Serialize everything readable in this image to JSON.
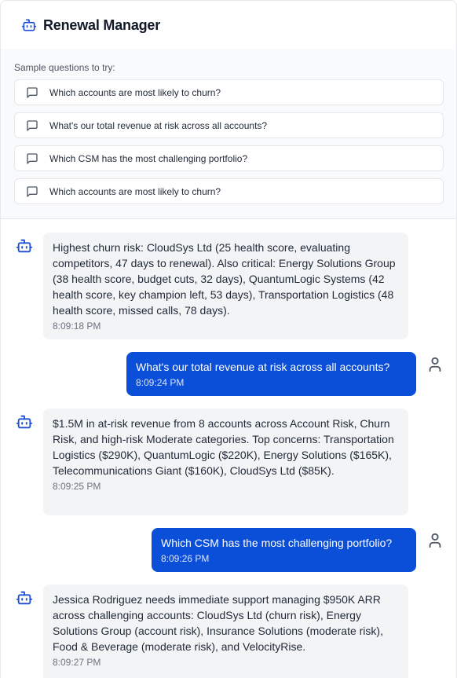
{
  "header": {
    "title": "Renewal Manager",
    "icon": "bot-icon"
  },
  "samples": {
    "label": "Sample questions to try:",
    "items": [
      "Which accounts are most likely to churn?",
      "What's our total revenue at risk across all accounts?",
      "Which CSM has the most challenging portfolio?",
      "Which accounts are most likely to churn?"
    ]
  },
  "messages": [
    {
      "role": "bot",
      "text": "Highest churn risk: CloudSys Ltd (25 health score, evaluating competitors, 47 days to renewal). Also critical: Energy Solutions Group (38 health score, budget cuts, 32 days), QuantumLogic Systems (42 health score, key champion left, 53 days), Transportation Logistics (48 health score, missed calls, 78 days).",
      "time": "8:09:18 PM"
    },
    {
      "role": "user",
      "text": "What's our total revenue at risk across all accounts?",
      "time": "8:09:24 PM"
    },
    {
      "role": "bot",
      "text": "$1.5M in at-risk revenue from 8 accounts across Account Risk, Churn Risk, and high-risk Moderate categories. Top concerns: Transportation Logistics ($290K), QuantumLogic ($220K), Energy Solutions ($165K), Telecommunications Giant ($160K), CloudSys Ltd ($85K).",
      "time": "8:09:25 PM"
    },
    {
      "role": "user",
      "text": "Which CSM has the most challenging portfolio?",
      "time": "8:09:26 PM"
    },
    {
      "role": "bot",
      "text": "Jessica Rodriguez needs immediate support managing $950K ARR across challenging accounts: CloudSys Ltd (churn risk), Energy Solutions Group (account risk), Insurance Solutions (moderate risk), Food & Beverage (moderate risk), and VelocityRise.",
      "time": "8:09:27 PM"
    }
  ],
  "colors": {
    "user_bubble": "#0b4fd8",
    "bot_bubble": "#f3f4f6",
    "accent_icon": "#1d4ed8"
  }
}
